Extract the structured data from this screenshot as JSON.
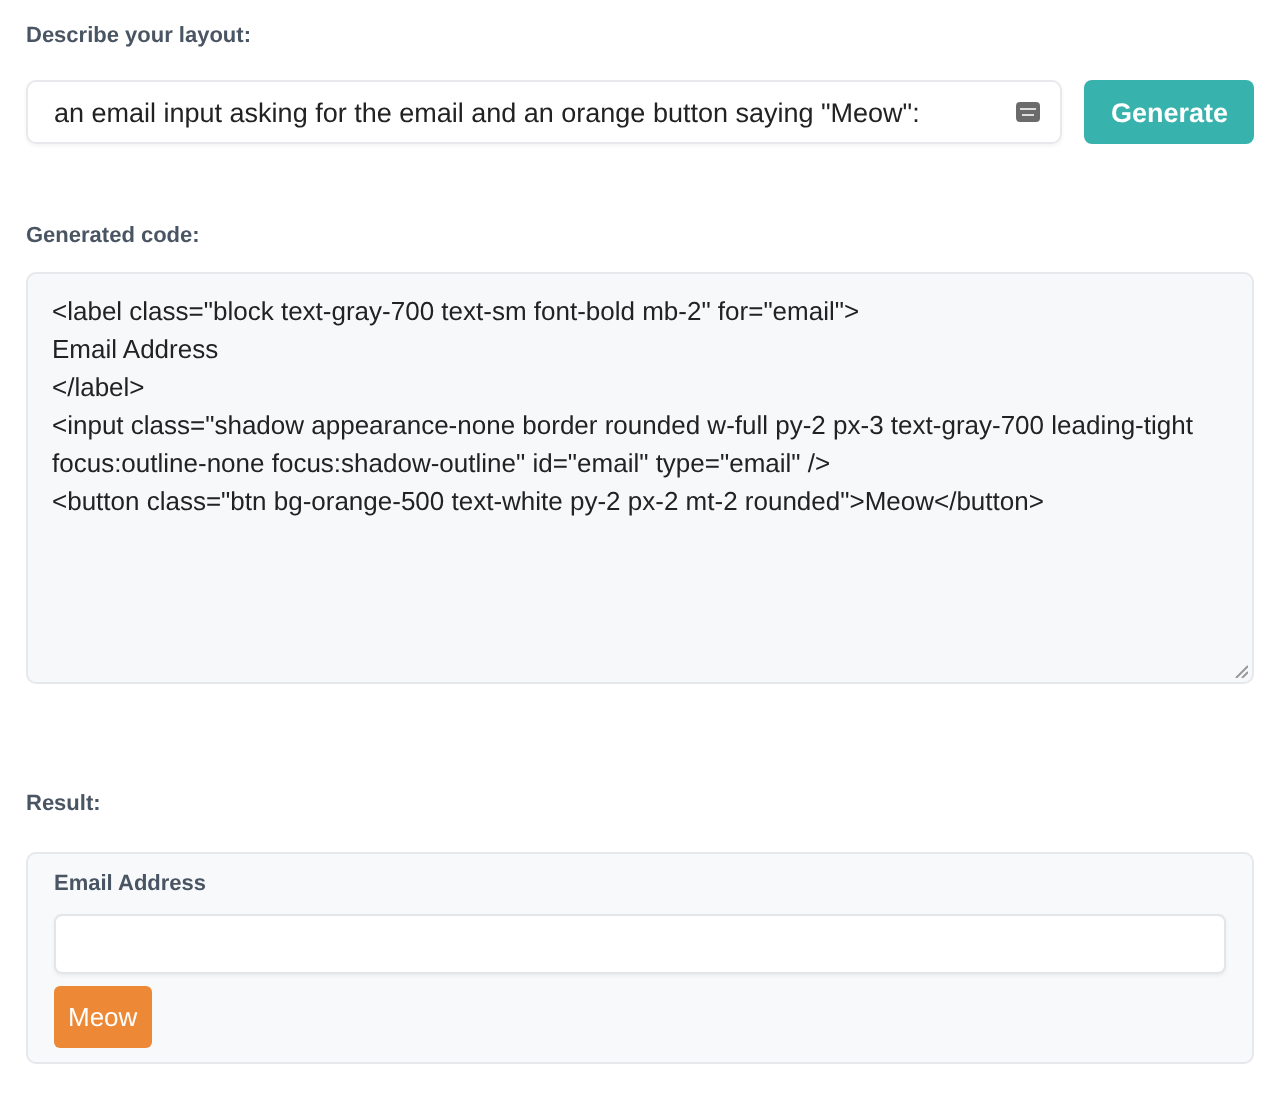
{
  "prompt": {
    "label": "Describe your layout:",
    "value": "an email input asking for the email and an orange button saying \"Meow\":",
    "button": "Generate"
  },
  "code": {
    "label": "Generated code:",
    "lines": [
      "<label class=\"block text-gray-700 text-sm font-bold mb-2\" for=\"email\">",
      "Email Address",
      "</label>",
      "<input class=\"shadow appearance-none border rounded w-full py-2 px-3 text-gray-700 leading-tight focus:outline-none focus:shadow-outline\" id=\"email\" type=\"email\" />",
      "<button class=\"btn bg-orange-500 text-white py-2 px-2 mt-2 rounded\">Meow</button>"
    ]
  },
  "result": {
    "label": "Result:",
    "field_label": "Email Address",
    "button": "Meow"
  }
}
